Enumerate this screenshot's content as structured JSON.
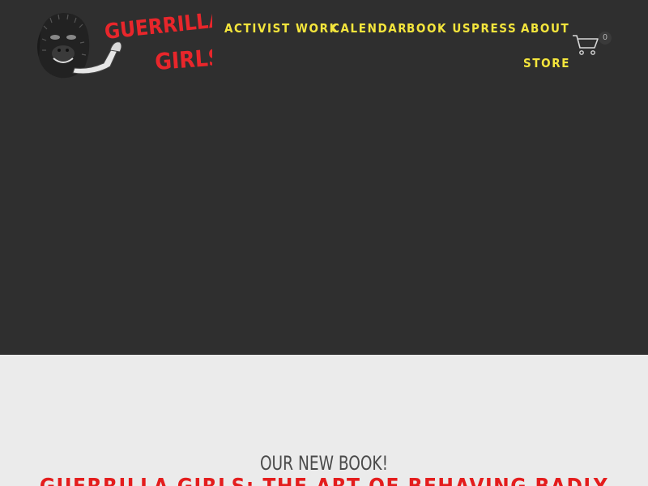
{
  "brand": {
    "logo_line1": "GUERRILLA",
    "logo_line2": "GIRLS",
    "logo_text_color": "#e8262b"
  },
  "nav": {
    "items": [
      {
        "label": "ACTIVIST WORK"
      },
      {
        "label": "CALENDAR"
      },
      {
        "label": "BOOK US"
      },
      {
        "label": "PRESS"
      },
      {
        "label": "ABOUT"
      },
      {
        "label": "STORE"
      }
    ],
    "color": "#f4e53c"
  },
  "cart": {
    "icon": "shopping-cart-icon",
    "count": "0"
  },
  "promo": {
    "kicker": "OUR NEW BOOK!",
    "title": "GUERRILLA GIRLS: THE ART OF BEHAVING BADLY",
    "title_color": "#e41d1d"
  },
  "colors": {
    "header_bg": "#2f2f2f",
    "page_bg": "#ebebeb"
  }
}
